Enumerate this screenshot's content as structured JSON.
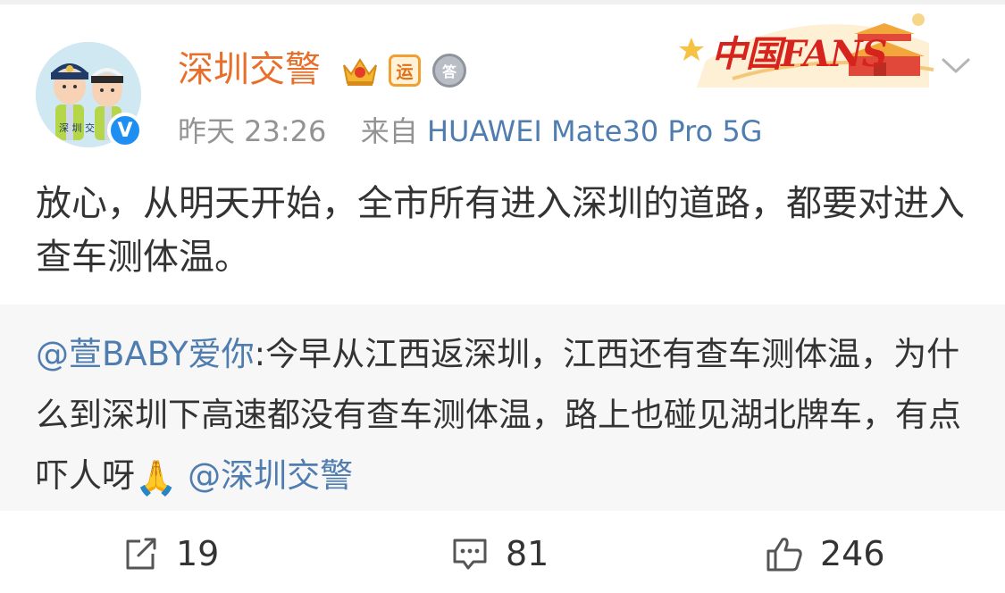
{
  "post": {
    "author_name": "深圳交警",
    "badges": [
      "crown-badge",
      "yun-badge",
      "medal-badge"
    ],
    "badge_yun_text": "运",
    "badge_medal_text": "答",
    "avatar_caption": "深 圳 交",
    "verified": "V",
    "time": "昨天 23:26",
    "source_prefix": "来自",
    "device": "HUAWEI Mate30 Pro 5G",
    "banner_text": "中国FANS",
    "text": "放心，从明天开始，全市所有进入深圳的道路，都要对进入查车测体温。"
  },
  "retweet": {
    "user_mention": "@萱BABY爱你",
    "body": ":今早从江西返深圳，江西还有查车测体温，为什么到深圳下高速都没有查车测体温，路上也碰见湖北牌车，有点吓人呀",
    "emoji": "🙏",
    "mention_end": " @深圳交警"
  },
  "actions": {
    "repost_count": "19",
    "comment_count": "81",
    "like_count": "246"
  },
  "colors": {
    "name": "#e86f2a",
    "link": "#507daf",
    "meta": "#939393",
    "text": "#333333",
    "quote_bg": "#f7f7f7",
    "verified": "#1d8ff2"
  }
}
